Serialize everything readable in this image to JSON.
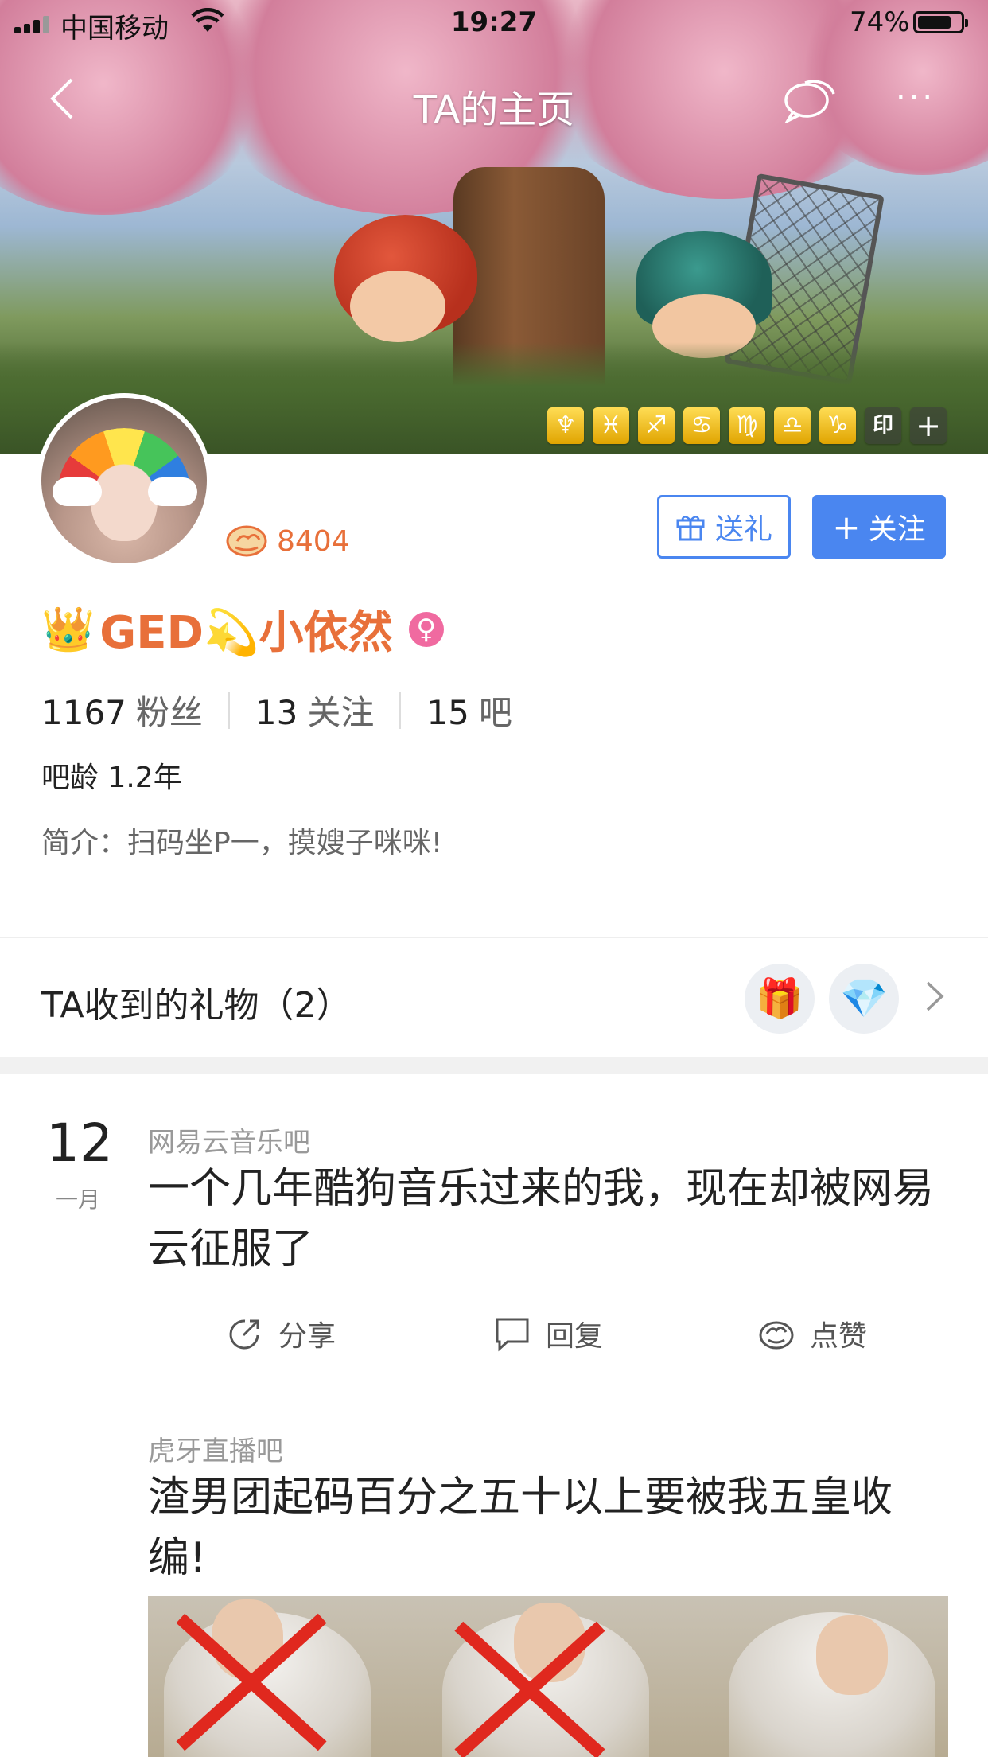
{
  "status_bar": {
    "carrier": "中国移动",
    "time": "19:27",
    "battery": "74%"
  },
  "nav": {
    "title": "TA的主页",
    "more": "···"
  },
  "zodiac_badges": [
    "♆",
    "♓",
    "♐",
    "♋",
    "♍",
    "♎",
    "♑",
    "印",
    "+"
  ],
  "profile": {
    "like_count": "8404",
    "gift_button": "送礼",
    "follow_button": "关注",
    "follow_plus": "+",
    "crown": "👑",
    "username": "GED💫小依然",
    "gender": "♀",
    "stats": [
      {
        "value": "1167",
        "label": "粉丝"
      },
      {
        "value": "13",
        "label": "关注"
      },
      {
        "value": "15",
        "label": "吧"
      }
    ],
    "bar_age": "吧龄 1.2年",
    "intro": "简介：扫码坐P一，摸嫂子咪咪!"
  },
  "gifts": {
    "title": "TA收到的礼物（2）",
    "items": [
      "🎁",
      "💎"
    ]
  },
  "posts": [
    {
      "day": "12",
      "month": "一月",
      "forum": "网易云音乐吧",
      "title": "一个几年酷狗音乐过来的我，现在却被网易云征服了",
      "actions": {
        "share": "分享",
        "reply": "回复",
        "like": "点赞"
      }
    },
    {
      "forum": "虎牙直播吧",
      "title": "渣男团起码百分之五十以上要被我五皇收编!"
    }
  ],
  "colors": {
    "accent": "#4a86f0",
    "username": "#e8703a",
    "gender": "#f06aa0"
  }
}
